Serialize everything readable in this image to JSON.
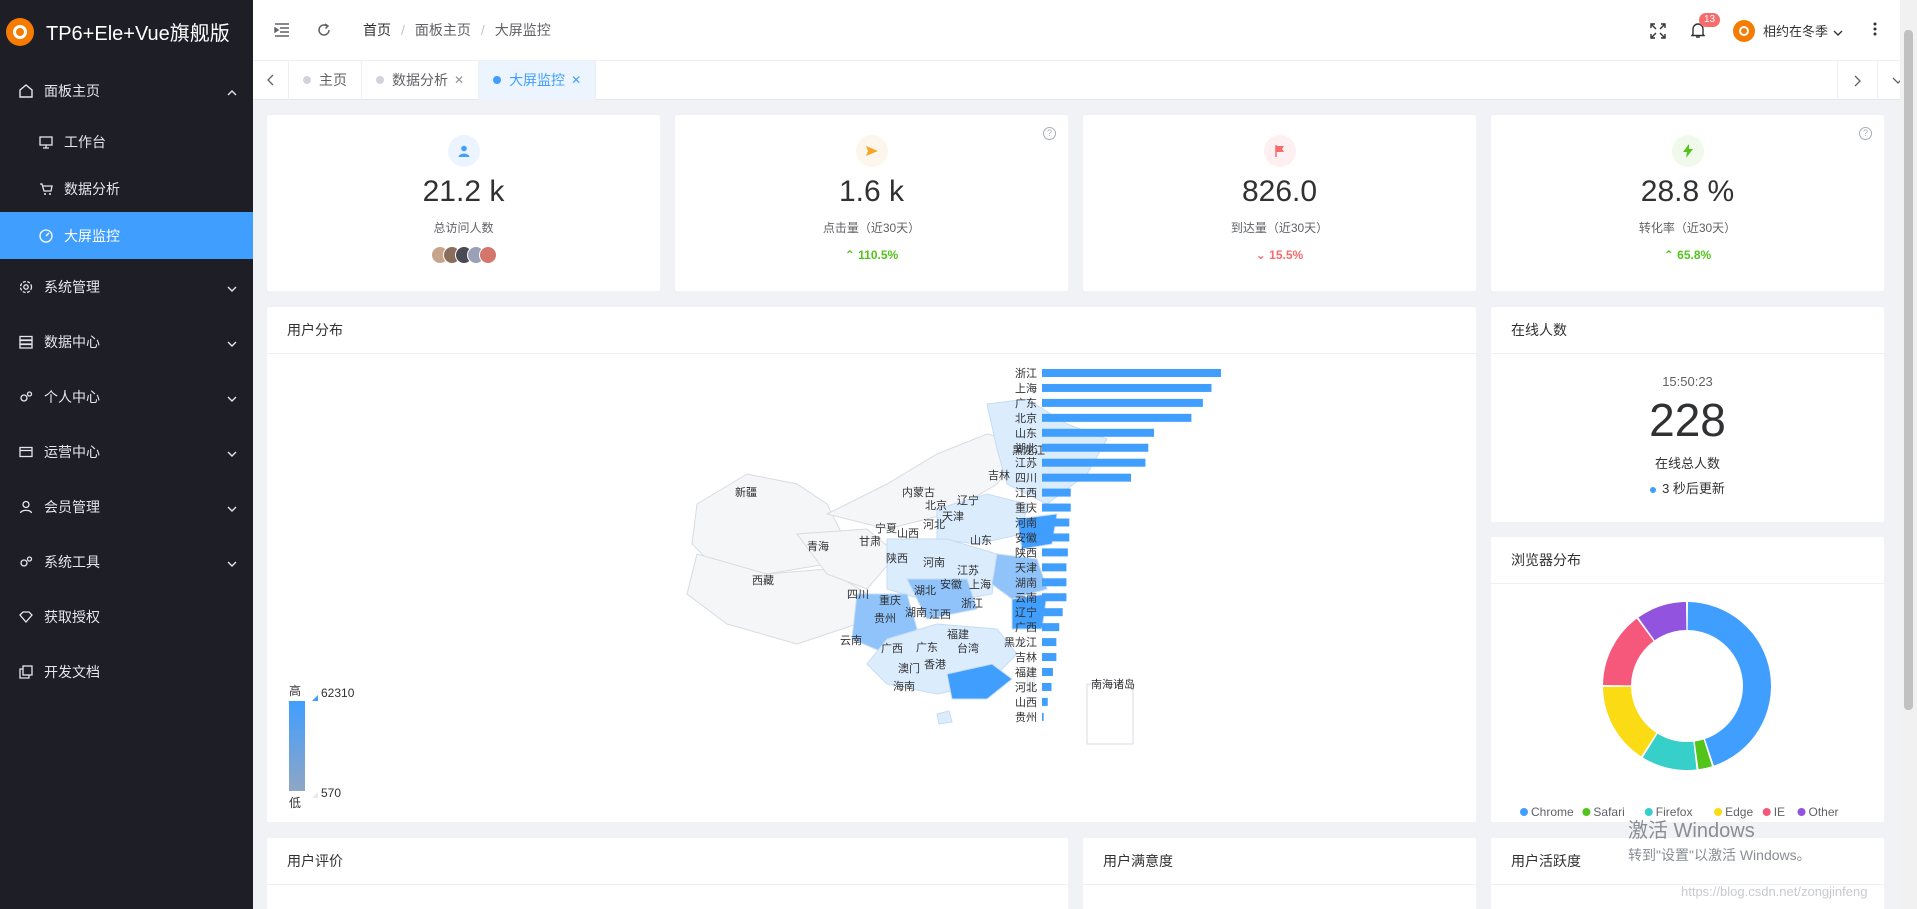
{
  "app": {
    "title": "TP6+Ele+Vue旗舰版"
  },
  "sidebar": {
    "items": [
      {
        "label": "面板主页",
        "icon": "home-icon",
        "expanded": true
      },
      {
        "label": "系统管理",
        "icon": "gear-icon"
      },
      {
        "label": "数据中心",
        "icon": "database-icon"
      },
      {
        "label": "个人中心",
        "icon": "gears-icon"
      },
      {
        "label": "运营中心",
        "icon": "card-icon"
      },
      {
        "label": "会员管理",
        "icon": "user-icon"
      },
      {
        "label": "系统工具",
        "icon": "gears-icon"
      },
      {
        "label": "获取授权",
        "icon": "diamond-icon"
      },
      {
        "label": "开发文档",
        "icon": "copy-icon"
      }
    ],
    "sub_items": [
      {
        "label": "工作台",
        "icon": "monitor-icon"
      },
      {
        "label": "数据分析",
        "icon": "cart-icon"
      },
      {
        "label": "大屏监控",
        "icon": "dashboard-icon",
        "active": true
      }
    ]
  },
  "header": {
    "breadcrumb": [
      "首页",
      "面板主页",
      "大屏监控"
    ],
    "notification_count": "13",
    "user_name": "相约在冬季"
  },
  "tabs": [
    {
      "label": "主页",
      "closable": false
    },
    {
      "label": "数据分析",
      "closable": true
    },
    {
      "label": "大屏监控",
      "closable": true,
      "active": true
    }
  ],
  "stats": [
    {
      "value": "21.2 k",
      "label": "总访问人数",
      "icon": "user-icon",
      "color": "#409eff",
      "bg": "#ecf5ff"
    },
    {
      "value": "1.6 k",
      "label": "点击量（近30天）",
      "icon": "send-icon",
      "color": "#f5a623",
      "bg": "#fdf6ec",
      "trend": "110.5%",
      "trend_dir": "up",
      "help": "?"
    },
    {
      "value": "826.0",
      "label": "到达量（近30天）",
      "icon": "flag-icon",
      "color": "#f56c6c",
      "bg": "#fef0f0",
      "trend": "15.5%",
      "trend_dir": "down"
    },
    {
      "value": "28.8 %",
      "label": "转化率（近30天）",
      "icon": "bolt-icon",
      "color": "#52c41a",
      "bg": "#f0f9eb",
      "trend": "65.8%",
      "trend_dir": "up",
      "help": "?"
    }
  ],
  "user_dist": {
    "title": "用户分布",
    "legend_high": "高",
    "legend_low": "低",
    "legend_max": "62310",
    "legend_min": "570",
    "map_labels": {
      "heilongjiang": "黑龙江",
      "jilin": "吉林",
      "liaoning": "辽宁",
      "neimenggu": "内蒙古",
      "beijing": "北京",
      "tianjin": "天津",
      "hebei": "河北",
      "shanxi": "山西",
      "shandong": "山东",
      "ningxia": "宁夏",
      "xinjiang": "新疆",
      "qinghai": "青海",
      "gansu": "甘肃",
      "shaanxi": "陕西",
      "henan": "河南",
      "jiangsu": "江苏",
      "anhui": "安徽",
      "shanghai": "上海",
      "xizang": "西藏",
      "sichuan": "四川",
      "chongqing": "重庆",
      "hubei": "湖北",
      "zhejiang": "浙江",
      "guizhou": "贵州",
      "hunan": "湖南",
      "jiangxi": "江西",
      "fujian": "福建",
      "yunnan": "云南",
      "guangxi": "广西",
      "guangdong": "广东",
      "taiwan": "台湾",
      "aomen": "澳门",
      "xianggang": "香港",
      "hainan": "海南",
      "nanhai": "南海诸岛"
    },
    "colors": {
      "bar": "#409eff",
      "high": "#409eff",
      "mid": "#8fc3fa",
      "low": "#dbecfd",
      "none": "#f5f6f7"
    }
  },
  "chart_data": [
    {
      "type": "bar",
      "categories": [
        "浙江",
        "上海",
        "广东",
        "北京",
        "山东",
        "湖北",
        "江苏",
        "四川",
        "江西",
        "重庆",
        "河南",
        "安徽",
        "陕西",
        "天津",
        "湖南",
        "云南",
        "辽宁",
        "广西",
        "黑龙江",
        "吉林",
        "福建",
        "河北",
        "山西",
        "贵州"
      ],
      "values": [
        62310,
        59000,
        56000,
        52000,
        39000,
        37000,
        36000,
        31000,
        10000,
        10000,
        9500,
        9500,
        9000,
        8500,
        8500,
        8500,
        7200,
        6000,
        5000,
        5000,
        3800,
        3300,
        2000,
        570
      ],
      "orientation": "horizontal",
      "xlim": [
        0,
        62310
      ]
    },
    {
      "type": "pie",
      "title": "浏览器分布",
      "categories": [
        "Chrome",
        "Safari",
        "Firefox",
        "Edge",
        "IE",
        "Other"
      ],
      "values": [
        45,
        3,
        11,
        16,
        15,
        10
      ],
      "colors": [
        "#409eff",
        "#52c41a",
        "#36cfc9",
        "#fadb14",
        "#f5587b",
        "#9254de"
      ]
    }
  ],
  "online": {
    "title": "在线人数",
    "time": "15:50:23",
    "count": "228",
    "label": "在线总人数",
    "refresh": "3 秒后更新"
  },
  "browser": {
    "title": "浏览器分布"
  },
  "bottom": {
    "reviews": "用户评价",
    "satisfaction": "用户满意度",
    "activity": "用户活跃度"
  },
  "watermark": {
    "line1": "激活 Windows",
    "line2": "转到\"设置\"以激活 Windows。",
    "url": "https://blog.csdn.net/zongjinfeng"
  }
}
